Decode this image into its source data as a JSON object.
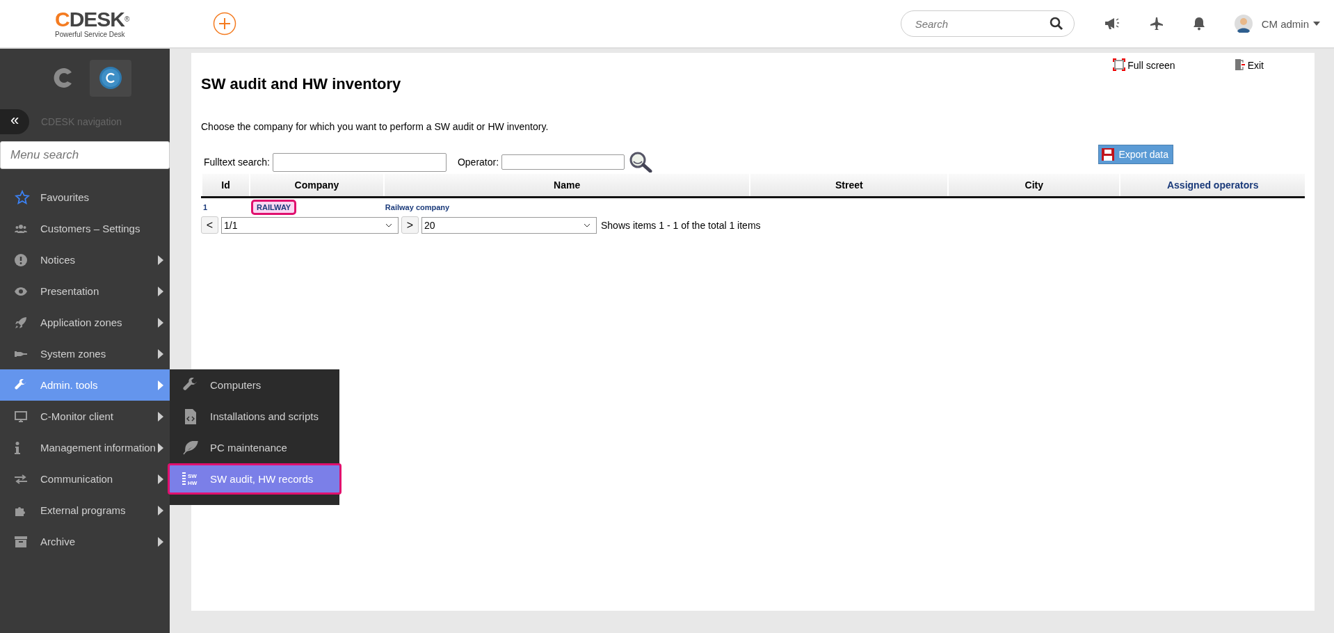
{
  "header": {
    "logo_text": "CDESK",
    "logo_mark": "®",
    "tagline": "Powerful Service Desk",
    "search": {
      "placeholder": "Search"
    },
    "user": "CM admin"
  },
  "sidebar": {
    "nav_label": "CDESK navigation",
    "toggle": "«",
    "search": {
      "placeholder": "Menu search"
    },
    "items": [
      {
        "label": "Favourites",
        "submenu": false,
        "selected": false
      },
      {
        "label": "Customers – Settings",
        "submenu": false,
        "selected": false
      },
      {
        "label": "Notices",
        "submenu": true,
        "selected": false
      },
      {
        "label": "Presentation",
        "submenu": true,
        "selected": false
      },
      {
        "label": "Application zones",
        "submenu": true,
        "selected": false
      },
      {
        "label": "System zones",
        "submenu": true,
        "selected": false
      },
      {
        "label": "Admin. tools",
        "submenu": true,
        "selected": true
      },
      {
        "label": "C-Monitor client",
        "submenu": true,
        "selected": false
      },
      {
        "label": "Management information",
        "submenu": true,
        "selected": false
      },
      {
        "label": "Communication",
        "submenu": true,
        "selected": false
      },
      {
        "label": "External programs",
        "submenu": true,
        "selected": false
      },
      {
        "label": "Archive",
        "submenu": true,
        "selected": false
      }
    ],
    "submenu": [
      {
        "label": "Computers",
        "selected": false,
        "highlighted": false
      },
      {
        "label": "Installations and scripts",
        "selected": false,
        "highlighted": false
      },
      {
        "label": "PC maintenance",
        "selected": false,
        "highlighted": false
      },
      {
        "label": "SW audit, HW records",
        "selected": true,
        "highlighted": true,
        "icon_text": [
          "SW",
          "HW"
        ]
      }
    ]
  },
  "page": {
    "title": "SW audit and HW inventory",
    "full_screen": "Full screen",
    "exit": "Exit",
    "description": "Choose the company for which you want to perform a SW audit or HW inventory.",
    "fulltext_label": "Fulltext search:",
    "operator_label": "Operator:",
    "export": "Export data",
    "table": {
      "columns": [
        {
          "label": "Id",
          "link": false
        },
        {
          "label": "Company",
          "link": false
        },
        {
          "label": "Name",
          "link": false
        },
        {
          "label": "Street",
          "link": false
        },
        {
          "label": "City",
          "link": false
        },
        {
          "label": "Assigned operators",
          "link": true
        }
      ],
      "rows": [
        {
          "id": "1",
          "company": "RAILWAY",
          "company_highlighted": true,
          "name": "Railway company"
        }
      ]
    },
    "pager": {
      "prev": "<",
      "page": "1/1",
      "next": ">",
      "page_size": "20",
      "info": "Shows items 1 - 1 of the total 1 items"
    }
  }
}
